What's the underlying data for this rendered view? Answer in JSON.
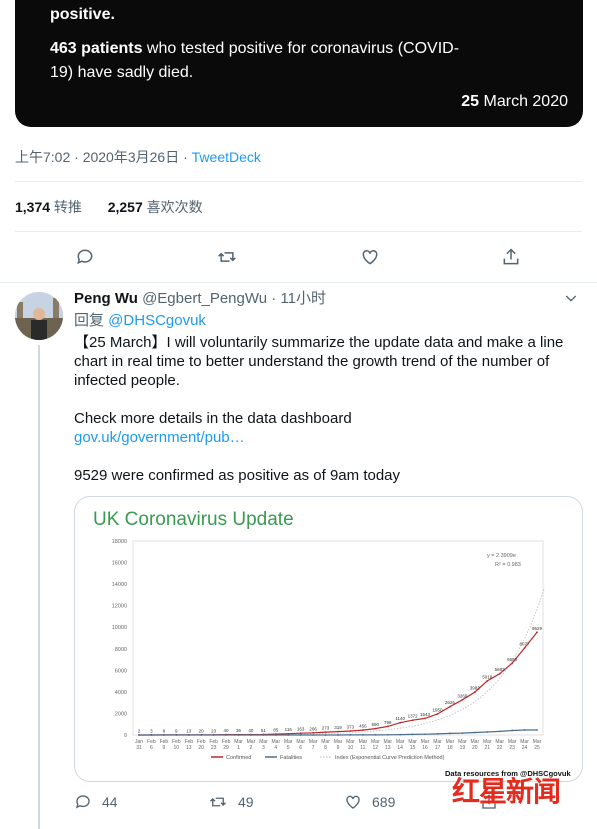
{
  "top_card": {
    "line1": "positive.",
    "count_bold": "463 patients",
    "count_rest": " who tested positive for coronavirus (COVID-19) have sadly died.",
    "date_day": "25",
    "date_rest": " March 2020"
  },
  "tweet_meta": {
    "time_text": "上午7:02 · 2020年3月26日 · ",
    "source": "TweetDeck"
  },
  "stats": {
    "retweets_num": "1,374",
    "retweets_label": " 转推",
    "likes_num": "2,257",
    "likes_label": " 喜欢次数"
  },
  "reply_tweet": {
    "name": "Peng Wu",
    "handle": "@Egbert_PengWu",
    "time": " · 11小时",
    "reply_prefix": "回复 ",
    "reply_to": "@DHSCgovuk",
    "body_p1": "【25 March】I will voluntarily summarize the update data and make a line chart in real time to better understand the growth trend of the number of infected people.",
    "body_p2_text": "Check more details in the data dashboard",
    "body_p2_link": "gov.uk/government/pub…",
    "body_p3": "9529 were confirmed as positive as of 9am today",
    "replies": "44",
    "retweets": "49",
    "likes": "689"
  },
  "chart_data": {
    "type": "line",
    "title": "UK Coronavirus Update",
    "ylim": [
      0,
      18000
    ],
    "y_ticks": [
      "0",
      "2000",
      "4000",
      "6000",
      "8000",
      "10000",
      "12000",
      "14000",
      "16000",
      "18000"
    ],
    "categories_top": [
      "Jan",
      "Feb",
      "Feb",
      "Feb",
      "Feb",
      "Feb",
      "Feb",
      "Feb",
      "Mar",
      "Mar",
      "Mar",
      "Mar",
      "Mar",
      "Mar",
      "Mar",
      "Mar",
      "Mar",
      "Mar",
      "Mar",
      "Mar",
      "Mar",
      "Mar",
      "Mar",
      "Mar",
      "Mar",
      "Mar",
      "Mar",
      "Mar",
      "Mar",
      "Mar",
      "Mar",
      "Mar",
      "Mar",
      "Mar",
      "Mar"
    ],
    "categories_bottom": [
      "31",
      "6",
      "9",
      "10",
      "13",
      "20",
      "23",
      "29",
      "1",
      "2",
      "3",
      "4",
      "5",
      "6",
      "7",
      "8",
      "9",
      "10",
      "11",
      "12",
      "13",
      "14",
      "15",
      "16",
      "17",
      "18",
      "19",
      "20",
      "21",
      "22",
      "23",
      "24",
      "25"
    ],
    "series": [
      {
        "name": "Confirmed",
        "color": "#c0282b",
        "values": [
          2,
          3,
          8,
          9,
          13,
          20,
          23,
          40,
          36,
          40,
          51,
          85,
          116,
          163,
          206,
          273,
          319,
          373,
          456,
          590,
          798,
          1140,
          1372,
          1543,
          1950,
          2626,
          3269,
          3983,
          5018,
          5683,
          6650,
          8077,
          9529
        ]
      },
      {
        "name": "Fatalities",
        "color": "#4a6d8c",
        "values": [
          0,
          0,
          0,
          0,
          0,
          0,
          0,
          0,
          0,
          0,
          0,
          0,
          1,
          2,
          2,
          3,
          4,
          6,
          8,
          10,
          21,
          35,
          55,
          71,
          104,
          144,
          177,
          233,
          281,
          335,
          422,
          463,
          463
        ]
      }
    ],
    "legend_third": "Index (Exponential Curve Prediction Method)",
    "equation": "y = 2.3909e",
    "r2": "R² = 0.983",
    "footer": "Data resources from @DHSCgovuk"
  },
  "watermark": {
    "text": "红星新闻"
  },
  "colors": {
    "accent": "#1d9bf0",
    "muted": "#536471"
  }
}
